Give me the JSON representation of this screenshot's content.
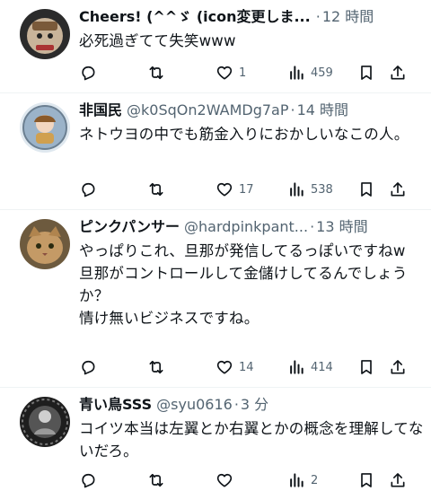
{
  "tweets": [
    {
      "name": "Cheers! (^^ゞ (icon変更しま...",
      "handle": "",
      "dot": "·",
      "time": "12 時間",
      "text": "必死過ぎてて失笑www",
      "replies": "",
      "retweets": "",
      "likes": "1",
      "views": "459",
      "avatar_color": "#c9b49a"
    },
    {
      "name": "非国民",
      "handle": "@k0SqOn2WAMDg7aP",
      "dot": "·",
      "time": "14 時間",
      "text": "ネトウヨの中でも筋金入りにおかしいなこの人。",
      "replies": "",
      "retweets": "",
      "likes": "17",
      "views": "538",
      "avatar_color": "#9bb3c9"
    },
    {
      "name": "ピンクパンサー",
      "handle": "@hardpinkpant...",
      "dot": "·",
      "time": "13 時間",
      "text": "やっぱりこれ、旦那が発信してるっぽいですねw\n旦那がコントロールして金儲けしてるんでしょうか？\n情け無いビジネスですね。",
      "replies": "",
      "retweets": "",
      "likes": "14",
      "views": "414",
      "avatar_color": "#b08a5a"
    },
    {
      "name": "青い鳥SSS",
      "handle": "@syu0616",
      "dot": "·",
      "time": "3 分",
      "text": "コイツ本当は左翼とか右翼とかの概念を理解してないだろ。",
      "replies": "",
      "retweets": "",
      "likes": "",
      "views": "2",
      "avatar_color": "#3a3a3a"
    }
  ],
  "icons": [
    "reply-icon",
    "retweet-icon",
    "like-icon",
    "views-icon",
    "bookmark-icon",
    "share-icon"
  ]
}
